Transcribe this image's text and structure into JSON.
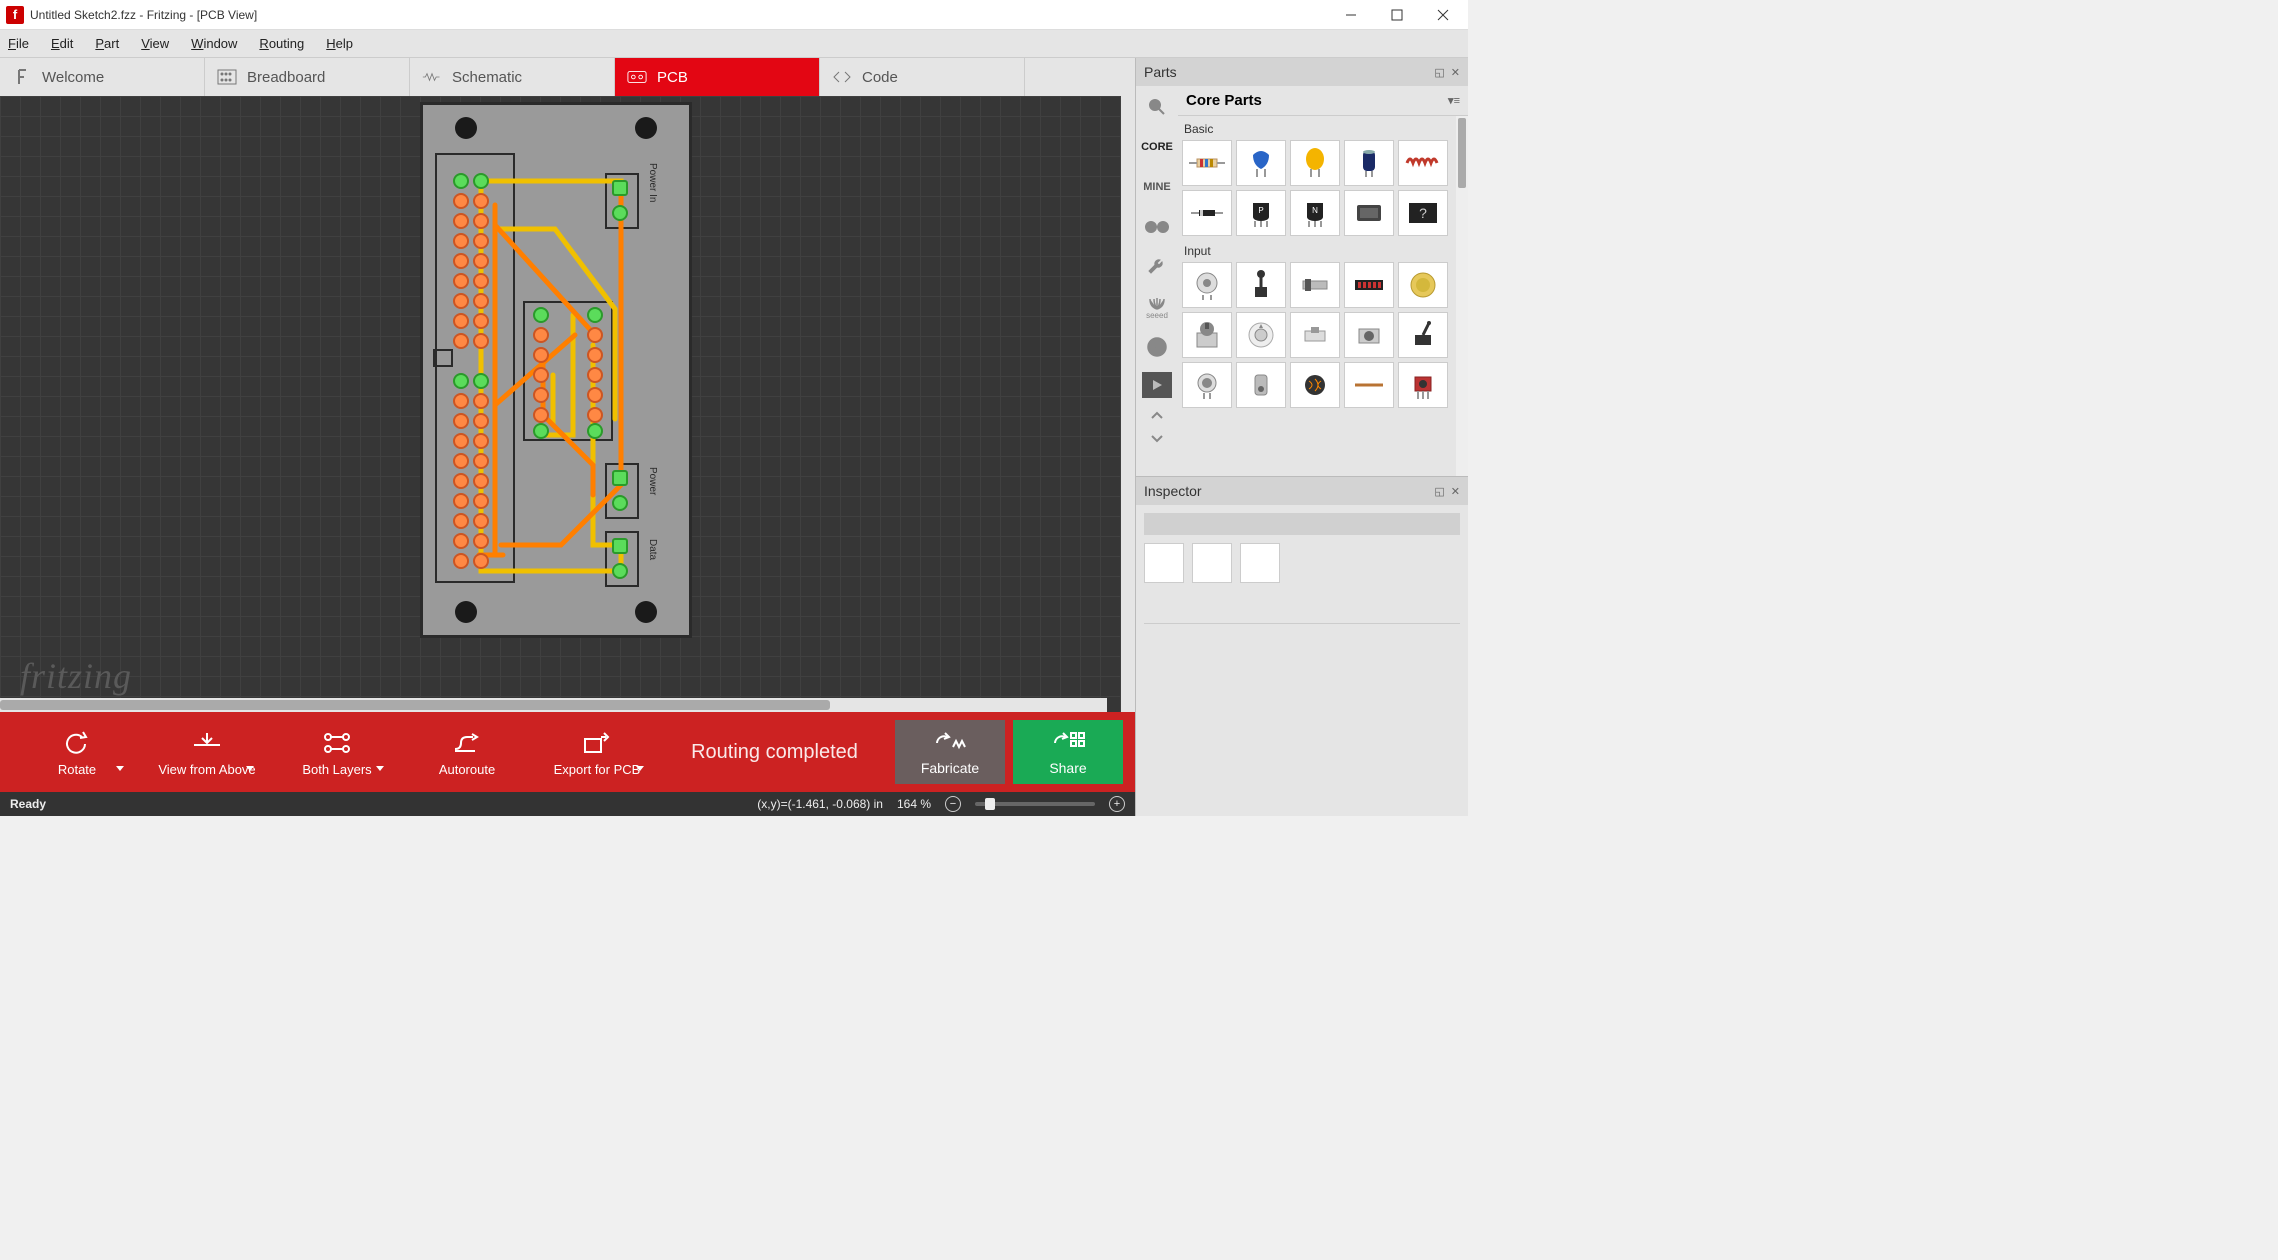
{
  "window": {
    "title": "Untitled Sketch2.fzz - Fritzing - [PCB View]",
    "app_letter": "f"
  },
  "menu": [
    "File",
    "Edit",
    "Part",
    "View",
    "Window",
    "Routing",
    "Help"
  ],
  "tabs": [
    {
      "id": "welcome",
      "label": "Welcome",
      "icon": "f-icon",
      "active": false
    },
    {
      "id": "breadboard",
      "label": "Breadboard",
      "icon": "breadboard-icon",
      "active": false
    },
    {
      "id": "schematic",
      "label": "Schematic",
      "icon": "schematic-icon",
      "active": false
    },
    {
      "id": "pcb",
      "label": "PCB",
      "icon": "pcb-icon",
      "active": true
    },
    {
      "id": "code",
      "label": "Code",
      "icon": "code-icon",
      "active": false
    }
  ],
  "canvas": {
    "watermark": "fritzing",
    "pcb_labels": {
      "power_in": "Power In",
      "power": "Power",
      "data": "Data"
    }
  },
  "toolbar": {
    "rotate": "Rotate",
    "view": "View from Above",
    "layers": "Both Layers",
    "autoroute": "Autoroute",
    "export": "Export for PCB",
    "routing_msg": "Routing completed",
    "fabricate": "Fabricate",
    "share": "Share"
  },
  "status": {
    "ready": "Ready",
    "coords": "(x,y)=(-1.461, -0.068) in",
    "zoom": "164 %"
  },
  "parts_panel": {
    "title": "Parts",
    "bin_title": "Core Parts",
    "bins": [
      "CORE",
      "MINE"
    ],
    "categories": [
      {
        "name": "Basic",
        "items": [
          "resistor",
          "capacitor-ceramic",
          "capacitor-tantalum",
          "capacitor-electrolytic",
          "inductor",
          "diode",
          "transistor-pnp",
          "transistor-npn",
          "relay",
          "mystery"
        ]
      },
      {
        "name": "Input",
        "items": [
          "rotary-encoder",
          "joystick",
          "slide-switch",
          "dip-switch",
          "coin-cell",
          "potentiometer",
          "rotary-dial",
          "tactile-button",
          "pushbutton",
          "toggle-switch",
          "microphone",
          "tilt-sensor",
          "photoresistor",
          "wire",
          "ir-sensor"
        ]
      }
    ]
  },
  "inspector": {
    "title": "Inspector"
  }
}
